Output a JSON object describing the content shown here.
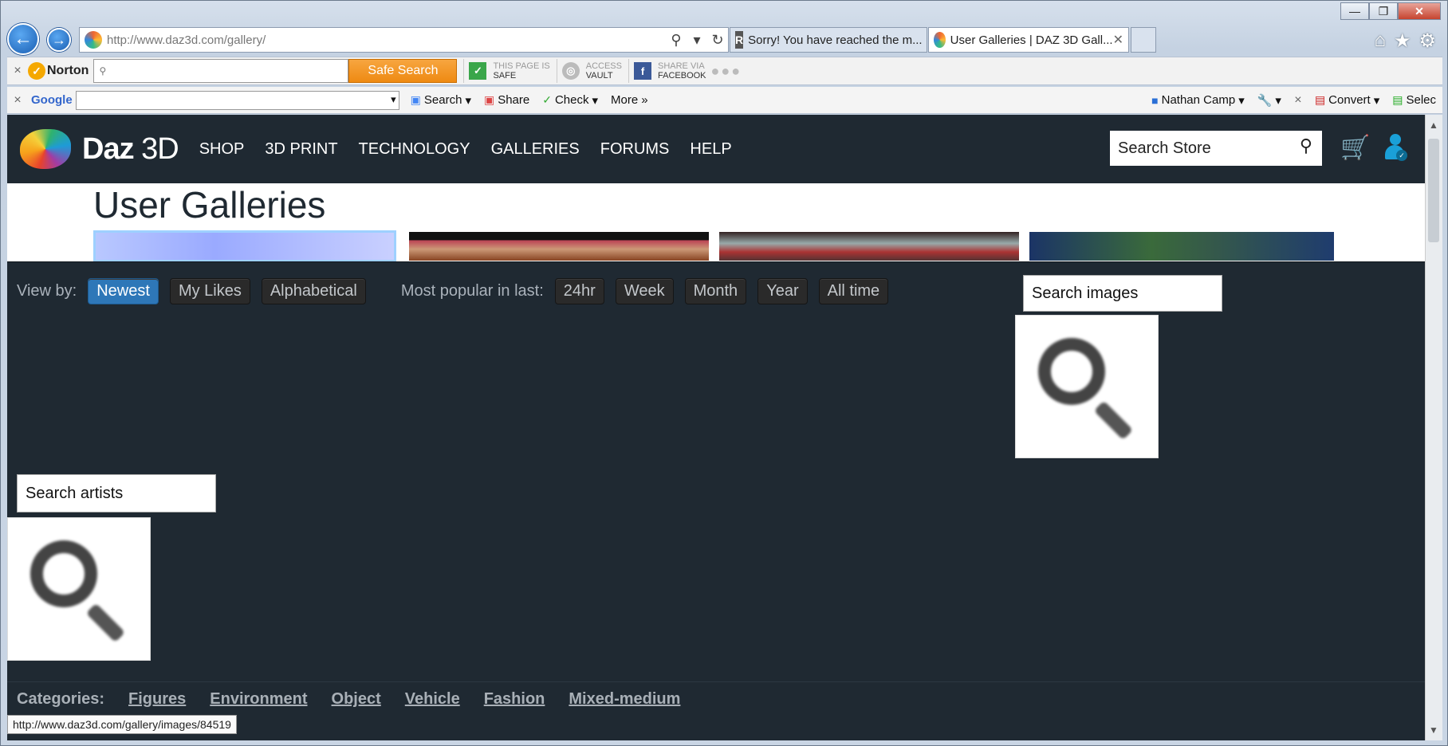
{
  "browser": {
    "address_url": "http://www.daz3d.com/gallery/",
    "tabs": [
      {
        "label": "Sorry! You have reached the m..."
      },
      {
        "label": "User Galleries | DAZ 3D Gall..."
      }
    ]
  },
  "norton": {
    "brand": "Norton",
    "search_placeholder": "",
    "safe_search_label": "Safe Search",
    "page_safe_top": "THIS PAGE IS",
    "page_safe_bottom": "SAFE",
    "vault_top": "ACCESS",
    "vault_bottom": "VAULT",
    "share_top": "SHARE VIA",
    "share_bottom": "FACEBOOK"
  },
  "google": {
    "brand": "Google",
    "search_label": "Search",
    "share_label": "Share",
    "check_label": "Check",
    "more_label": "More",
    "user_label": "Nathan Camp",
    "convert_label": "Convert",
    "select_label": "Selec"
  },
  "site": {
    "logo_daz": "Daz",
    "logo_3d": "3D",
    "nav": [
      "SHOP",
      "3D PRINT",
      "TECHNOLOGY",
      "GALLERIES",
      "FORUMS",
      "HELP"
    ],
    "store_search_placeholder": "Search Store"
  },
  "gallery": {
    "title": "User Galleries",
    "view_by_label": "View by:",
    "view_by_options": [
      "Newest",
      "My Likes",
      "Alphabetical"
    ],
    "popular_label": "Most popular in last:",
    "popular_options": [
      "24hr",
      "Week",
      "Month",
      "Year",
      "All time"
    ],
    "search_images_placeholder": "Search images",
    "search_artists_placeholder": "Search artists",
    "categories_label": "Categories:",
    "categories": [
      "Figures",
      "Environment",
      "Object",
      "Vehicle",
      "Fashion",
      "Mixed-medium"
    ]
  },
  "status_bar": {
    "text": "http://www.daz3d.com/gallery/images/84519"
  }
}
